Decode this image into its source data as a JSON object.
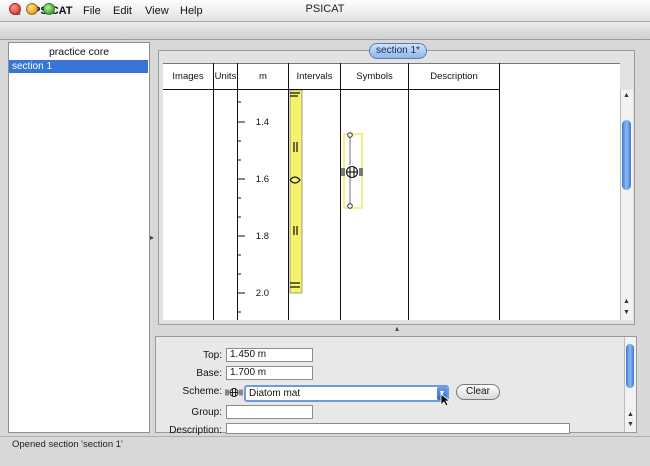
{
  "menubar": {
    "apple_icon": "apple-icon",
    "app_name": "PSICAT",
    "items": [
      "File",
      "Edit",
      "View",
      "Help"
    ]
  },
  "window": {
    "title": "PSICAT"
  },
  "left_panel": {
    "title": "practice core",
    "items": [
      {
        "label": "section 1",
        "selected": true
      }
    ]
  },
  "diagram": {
    "tab_label": "section 1*",
    "columns": [
      "Images",
      "Units",
      "m",
      "Intervals",
      "Symbols",
      "Description"
    ],
    "depth_labels": [
      "1.4",
      "1.6",
      "1.8",
      "2.0"
    ],
    "interval_color": "#f7f26b",
    "symbol_icon": "diatom-mat-icon"
  },
  "properties": {
    "top_label": "Top:",
    "top_value": "1.450 m",
    "base_label": "Base:",
    "base_value": "1.700 m",
    "scheme_label": "Scheme:",
    "scheme_icon": "diatom-mat-icon",
    "scheme_value": "Diatom mat",
    "clear_label": "Clear",
    "group_label": "Group:",
    "group_value": "",
    "description_label": "Description:",
    "description_value": ""
  },
  "status": {
    "text": "Opened section 'section 1'"
  },
  "colors": {
    "selection": "#3875d7",
    "accent_blue": "#6e9be0"
  }
}
